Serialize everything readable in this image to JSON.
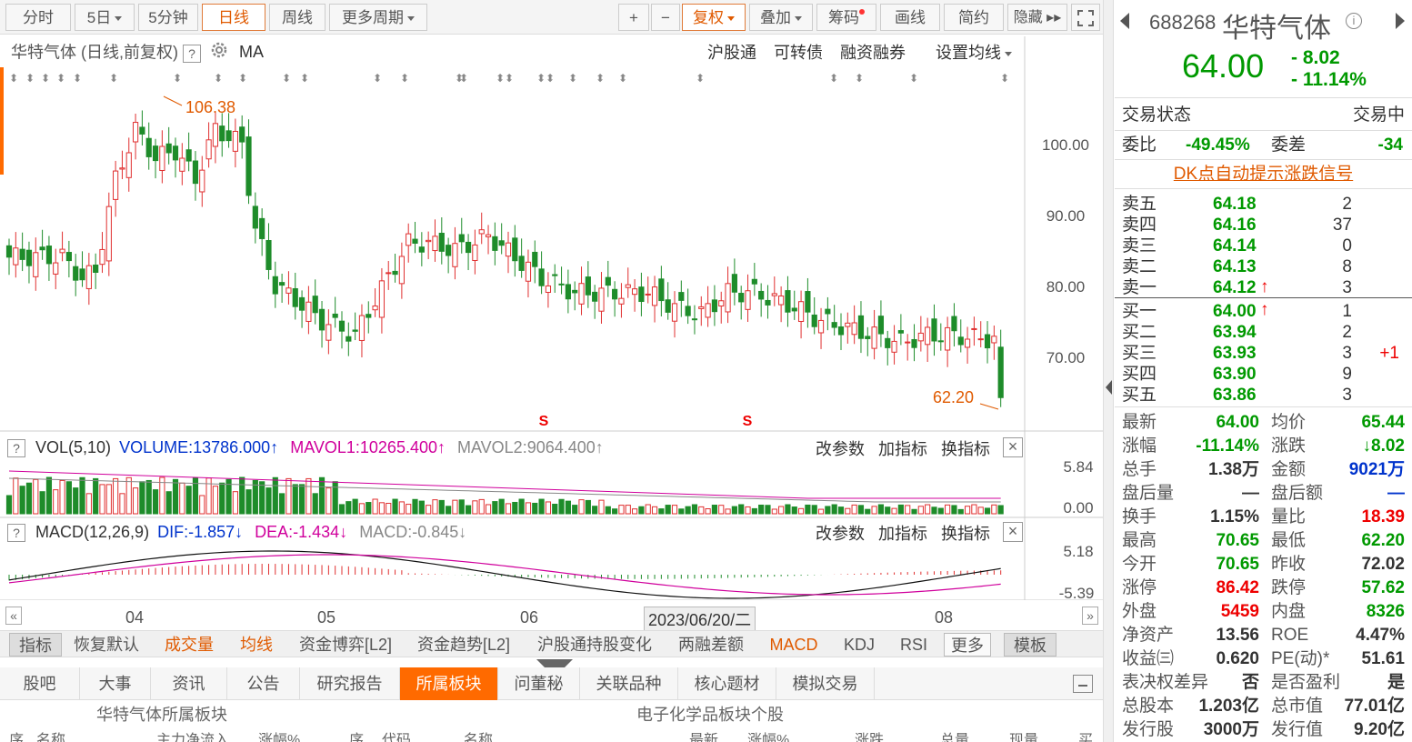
{
  "toolbar": {
    "periods": [
      "分时",
      "5日",
      "5分钟",
      "日线",
      "周线",
      "更多周期"
    ],
    "active_period": "日线",
    "tools": [
      "+",
      "−",
      "复权",
      "叠加",
      "筹码",
      "画线",
      "简约",
      "隐藏 ▸▸"
    ]
  },
  "chart_info": {
    "title": "华特气体 (日线,前复权)",
    "help": "?",
    "ma": "MA",
    "links": [
      "沪股通",
      "可转债",
      "融资融券",
      "设置均线"
    ],
    "price_axis": [
      "100.00",
      "90.00",
      "80.00",
      "70.00"
    ],
    "high_label": "106.38",
    "low_label": "62.20",
    "s_markers": [
      "S",
      "S"
    ]
  },
  "vol": {
    "name": "VOL(5,10)",
    "volume": "VOLUME:13786.000",
    "mavol1": "MAVOL1:10265.400",
    "mavol2": "MAVOL2:9064.400",
    "axis": [
      "5.84",
      "0.00"
    ],
    "actions": [
      "改参数",
      "加指标",
      "换指标"
    ]
  },
  "macd": {
    "name": "MACD(12,26,9)",
    "dif": "DIF:-1.857",
    "dea": "DEA:-1.434",
    "macd": "MACD:-0.845",
    "axis": [
      "5.18",
      "-5.39"
    ],
    "actions": [
      "改参数",
      "加指标",
      "换指标"
    ]
  },
  "time_axis": {
    "labels": [
      "04",
      "05",
      "06",
      "08"
    ],
    "cursor": "2023/06/20/二"
  },
  "indicator_tabs": [
    "指标",
    "恢复默认",
    "成交量",
    "均线",
    "资金博弈[L2]",
    "资金趋势[L2]",
    "沪股通持股变化",
    "两融差额",
    "MACD",
    "KDJ",
    "RSI",
    "更多",
    "模板"
  ],
  "info_tabs": [
    "股吧",
    "大事",
    "资讯",
    "公告",
    "研究报告",
    "所属板块",
    "问董秘",
    "关联品种",
    "核心题材",
    "模拟交易"
  ],
  "active_info_tab": "所属板块",
  "panels": {
    "left": "华特气体所属板块",
    "right": "电子化学品板块个股"
  },
  "table_head": [
    "序",
    "名称",
    "主力净流入",
    "涨幅%",
    "序",
    "代码",
    "名称",
    "最新",
    "涨幅%",
    "涨跌",
    "总量",
    "现量",
    "买"
  ],
  "quote": {
    "code": "688268",
    "name": "华特气体",
    "price": "64.00",
    "change": "- 8.02",
    "change_pct": "- 11.14%",
    "trade_status_label": "交易状态",
    "trade_status": "交易中",
    "wb_label": "委比",
    "wb": "-49.45%",
    "wc_label": "委差",
    "wc": "-34",
    "dk": "DK点自动提示涨跌信号",
    "asks": [
      {
        "label": "卖五",
        "price": "64.18",
        "vol": "2"
      },
      {
        "label": "卖四",
        "price": "64.16",
        "vol": "37"
      },
      {
        "label": "卖三",
        "price": "64.14",
        "vol": "0"
      },
      {
        "label": "卖二",
        "price": "64.13",
        "vol": "8"
      },
      {
        "label": "卖一",
        "price": "64.12",
        "vol": "3"
      }
    ],
    "bids": [
      {
        "label": "买一",
        "price": "64.00",
        "vol": "1",
        "extra": ""
      },
      {
        "label": "买二",
        "price": "63.94",
        "vol": "2",
        "extra": ""
      },
      {
        "label": "买三",
        "price": "63.93",
        "vol": "3",
        "extra": "+1"
      },
      {
        "label": "买四",
        "price": "63.90",
        "vol": "9",
        "extra": ""
      },
      {
        "label": "买五",
        "price": "63.86",
        "vol": "3",
        "extra": ""
      }
    ],
    "stats": [
      [
        "最新",
        "64.00",
        "均价",
        "65.44"
      ],
      [
        "涨幅",
        "-11.14%",
        "涨跌",
        "↓8.02"
      ],
      [
        "总手",
        "1.38万",
        "金额",
        "9021万"
      ],
      [
        "盘后量",
        "—",
        "盘后额",
        "—"
      ],
      [
        "换手",
        "1.15%",
        "量比",
        "18.39"
      ],
      [
        "最高",
        "70.65",
        "最低",
        "62.20"
      ],
      [
        "今开",
        "70.65",
        "昨收",
        "72.02"
      ],
      [
        "涨停",
        "86.42",
        "跌停",
        "57.62"
      ],
      [
        "外盘",
        "5459",
        "内盘",
        "8326"
      ],
      [
        "净资产",
        "13.56",
        "ROE",
        "4.47%"
      ],
      [
        "收益㈢",
        "0.620",
        "PE(动)*",
        "51.61"
      ],
      [
        "表决权差异",
        "否",
        "是否盈利",
        "是"
      ],
      [
        "总股本",
        "1.203亿",
        "总市值",
        "77.01亿"
      ],
      [
        "发行股",
        "3000万",
        "发行值",
        "9.20亿"
      ]
    ]
  },
  "colors": {
    "up": "#e03030",
    "down": "#1e8c2a",
    "accent": "#ff6a00",
    "mavol1": "#d0009c",
    "bg": "#ffffff"
  }
}
